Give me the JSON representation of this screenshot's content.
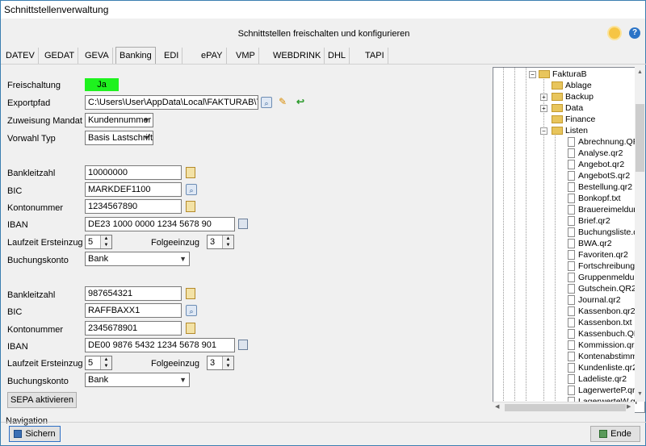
{
  "window": {
    "title": "Schnittstellenverwaltung"
  },
  "subtitle": "Schnittstellen freischalten und konfigurieren",
  "tabs": [
    "DATEV",
    "GEDAT",
    "GEVA",
    "Banking",
    "EDI",
    "ePAY",
    "VMP",
    "WEBDRINK",
    "DHL",
    "TAPI"
  ],
  "active_tab": "Banking",
  "form": {
    "freischaltung_label": "Freischaltung",
    "freischaltung_value": "Ja",
    "exportpfad_label": "Exportpfad",
    "exportpfad_value": "C:\\Users\\User\\AppData\\Local\\FAKTURAB\\Templ",
    "zuweisung_label": "Zuweisung Mandat",
    "zuweisung_value": "Kundennummer",
    "vorwahl_label": "Vorwahl Typ",
    "vorwahl_value": "Basis Lastschrift",
    "bank1": {
      "blz_label": "Bankleitzahl",
      "blz": "10000000",
      "bic_label": "BIC",
      "bic": "MARKDEF1100",
      "konto_label": "Kontonummer",
      "konto": "1234567890",
      "iban_label": "IBAN",
      "iban": "DE23 1000 0000 1234 5678 90",
      "laufzeit_label": "Laufzeit Ersteinzug",
      "laufzeit": "5",
      "folge_label": "Folgeeinzug",
      "folge": "3",
      "buchung_label": "Buchungskonto",
      "buchung": "Bank"
    },
    "bank2": {
      "blz_label": "Bankleitzahl",
      "blz": "987654321",
      "bic_label": "BIC",
      "bic": "RAFFBAXX1",
      "konto_label": "Kontonummer",
      "konto": "2345678901",
      "iban_label": "IBAN",
      "iban": "DE00 9876 5432 1234 5678 901",
      "laufzeit_label": "Laufzeit Ersteinzug",
      "laufzeit": "5",
      "folge_label": "Folgeeinzug",
      "folge": "3",
      "buchung_label": "Buchungskonto",
      "buchung": "Bank"
    },
    "sepa_button": "SEPA aktivieren"
  },
  "navigation_label": "Navigation",
  "buttons": {
    "save": "Sichern",
    "end": "Ende"
  },
  "tree": {
    "root": "FakturaB",
    "folders": [
      "Ablage",
      "Backup",
      "Data",
      "Finance",
      "Listen"
    ],
    "files": [
      "Abrechnung.QR",
      "Analyse.qr2",
      "Angebot.qr2",
      "AngebotS.qr2",
      "Bestellung.qr2",
      "Bonkopf.txt",
      "Brauereimeldung",
      "Brief.qr2",
      "Buchungsliste.qr",
      "BWA.qr2",
      "Favoriten.qr2",
      "Fortschreibung.c",
      "Gruppenmeldung",
      "Gutschein.QR2",
      "Journal.qr2",
      "Kassenbon.qr2",
      "Kassenbon.txt",
      "Kassenbuch.QR",
      "Kommission.qr2",
      "Kontenabstimmu",
      "Kundenliste.qr2",
      "Ladeliste.qr2",
      "LagerwerteP.qr2",
      "LagerwerteW.qr"
    ]
  }
}
